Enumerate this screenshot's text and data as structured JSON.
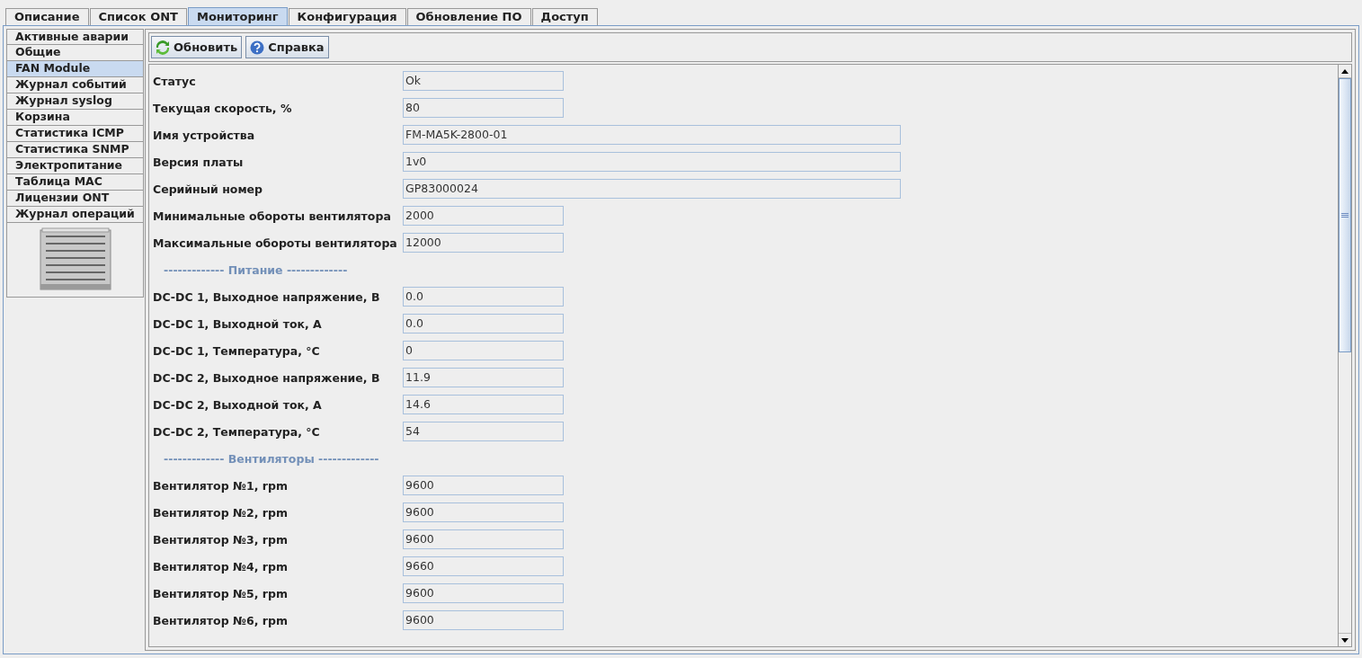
{
  "tabs": [
    {
      "label": "Описание",
      "selected": false
    },
    {
      "label": "Список ONT",
      "selected": false
    },
    {
      "label": "Мониторинг",
      "selected": true
    },
    {
      "label": "Конфигурация",
      "selected": false
    },
    {
      "label": "Обновление ПО",
      "selected": false
    },
    {
      "label": "Доступ",
      "selected": false
    }
  ],
  "sidebar": {
    "items": [
      {
        "label": "Активные аварии",
        "selected": false
      },
      {
        "label": "Общие",
        "selected": false
      },
      {
        "label": "FAN Module",
        "selected": true
      },
      {
        "label": "Журнал событий",
        "selected": false
      },
      {
        "label": "Журнал syslog",
        "selected": false
      },
      {
        "label": "Корзина",
        "selected": false
      },
      {
        "label": "Статистика ICMP",
        "selected": false
      },
      {
        "label": "Статистика SNMP",
        "selected": false
      },
      {
        "label": "Электропитание",
        "selected": false
      },
      {
        "label": "Таблица MAC",
        "selected": false
      },
      {
        "label": "Лицензии ONT",
        "selected": false
      },
      {
        "label": "Журнал операций",
        "selected": false
      }
    ]
  },
  "toolbar": [
    {
      "kind": "refresh",
      "label": "Обновить"
    },
    {
      "kind": "help",
      "label": "Справка"
    }
  ],
  "rows": [
    {
      "kind": "field",
      "label": "Статус",
      "value": "Ok",
      "wide": false
    },
    {
      "kind": "field",
      "label": "Текущая скорость, %",
      "value": "80",
      "wide": false
    },
    {
      "kind": "field",
      "label": "Имя устройства",
      "value": "FM-MA5K-2800-01",
      "wide": true
    },
    {
      "kind": "field",
      "label": "Версия платы",
      "value": "1v0",
      "wide": true
    },
    {
      "kind": "field",
      "label": "Серийный номер",
      "value": "GP83000024",
      "wide": true
    },
    {
      "kind": "field",
      "label": "Минимальные обороты вентилятора",
      "value": "2000",
      "wide": false
    },
    {
      "kind": "field",
      "label": "Максимальные обороты вентилятора",
      "value": "12000",
      "wide": false
    },
    {
      "kind": "section",
      "label": "------------- Питание -------------"
    },
    {
      "kind": "field",
      "label": "DC-DC 1, Выходное напряжение, В",
      "value": "0.0",
      "wide": false
    },
    {
      "kind": "field",
      "label": "DC-DC 1, Выходной ток, А",
      "value": "0.0",
      "wide": false
    },
    {
      "kind": "field",
      "label": "DC-DC 1, Температура, °C",
      "value": "0",
      "wide": false
    },
    {
      "kind": "field",
      "label": "DC-DC 2, Выходное напряжение, В",
      "value": "11.9",
      "wide": false
    },
    {
      "kind": "field",
      "label": "DC-DC 2, Выходной ток, А",
      "value": "14.6",
      "wide": false
    },
    {
      "kind": "field",
      "label": "DC-DC 2, Температура, °C",
      "value": "54",
      "wide": false
    },
    {
      "kind": "section",
      "label": "------------- Вентиляторы -------------"
    },
    {
      "kind": "field",
      "label": "Вентилятор №1, rpm",
      "value": "9600",
      "wide": false
    },
    {
      "kind": "field",
      "label": "Вентилятор №2, rpm",
      "value": "9600",
      "wide": false
    },
    {
      "kind": "field",
      "label": "Вентилятор №3, rpm",
      "value": "9600",
      "wide": false
    },
    {
      "kind": "field",
      "label": "Вентилятор №4, rpm",
      "value": "9660",
      "wide": false
    },
    {
      "kind": "field",
      "label": "Вентилятор №5, rpm",
      "value": "9600",
      "wide": false
    },
    {
      "kind": "field",
      "label": "Вентилятор №6, rpm",
      "value": "9600",
      "wide": false
    }
  ]
}
